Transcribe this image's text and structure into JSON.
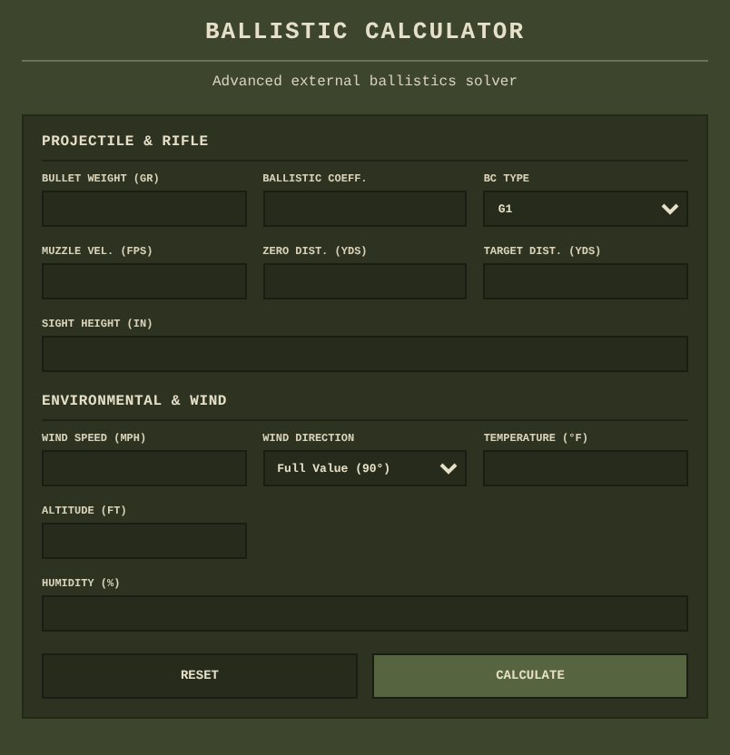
{
  "header": {
    "title": "BALLISTIC CALCULATOR",
    "subtitle": "Advanced external ballistics solver"
  },
  "sections": [
    {
      "title": "PROJECTILE & RIFLE",
      "fields": [
        {
          "kind": "input",
          "label": "BULLET WEIGHT (GR)",
          "full_width": false
        },
        {
          "kind": "input",
          "label": "BALLISTIC COEFF.",
          "full_width": false
        },
        {
          "kind": "select",
          "label": "BC TYPE",
          "value": "G1",
          "full_width": false
        },
        {
          "kind": "input",
          "label": "MUZZLE VEL. (FPS)",
          "full_width": false
        },
        {
          "kind": "input",
          "label": "ZERO DIST. (YDS)",
          "full_width": false
        },
        {
          "kind": "input",
          "label": "TARGET DIST. (YDS)",
          "full_width": false
        },
        {
          "kind": "input",
          "label": "SIGHT HEIGHT (IN)",
          "full_width": true
        }
      ]
    },
    {
      "title": "ENVIRONMENTAL & WIND",
      "fields": [
        {
          "kind": "input",
          "label": "WIND SPEED (MPH)",
          "full_width": false
        },
        {
          "kind": "select",
          "label": "WIND DIRECTION",
          "value": "Full Value (90°)",
          "full_width": false
        },
        {
          "kind": "input",
          "label": "TEMPERATURE (°F)",
          "full_width": false
        },
        {
          "kind": "input",
          "label": "ALTITUDE (FT)",
          "full_width": false
        },
        {
          "kind": "input",
          "label": "HUMIDITY (%)",
          "full_width": true
        }
      ]
    }
  ],
  "buttons": [
    {
      "label": "RESET",
      "kind": "secondary"
    },
    {
      "label": "CALCULATE",
      "kind": "primary"
    }
  ]
}
